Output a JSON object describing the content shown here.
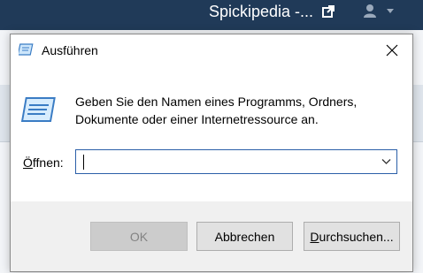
{
  "background": {
    "header_title": "Spickipedia -...",
    "icons": [
      "external-link-icon",
      "user-icon",
      "caret-down-icon"
    ],
    "header_color": "#203a58"
  },
  "dialog": {
    "title": "Ausführen",
    "description_line1": "Geben Sie den Namen eines Programms, Ordners,",
    "description_line2": "Dokumente oder einer Internetressource an.",
    "open_label_accel": "Ö",
    "open_label_rest": "ffnen:",
    "open_value": "",
    "buttons": {
      "ok": "OK",
      "cancel": "Abbrechen",
      "browse_accel": "D",
      "browse_rest": "urchsuchen..."
    },
    "icons": [
      "run-icon",
      "close-icon",
      "chevron-down-icon"
    ],
    "accent": "#2b5fa8"
  }
}
